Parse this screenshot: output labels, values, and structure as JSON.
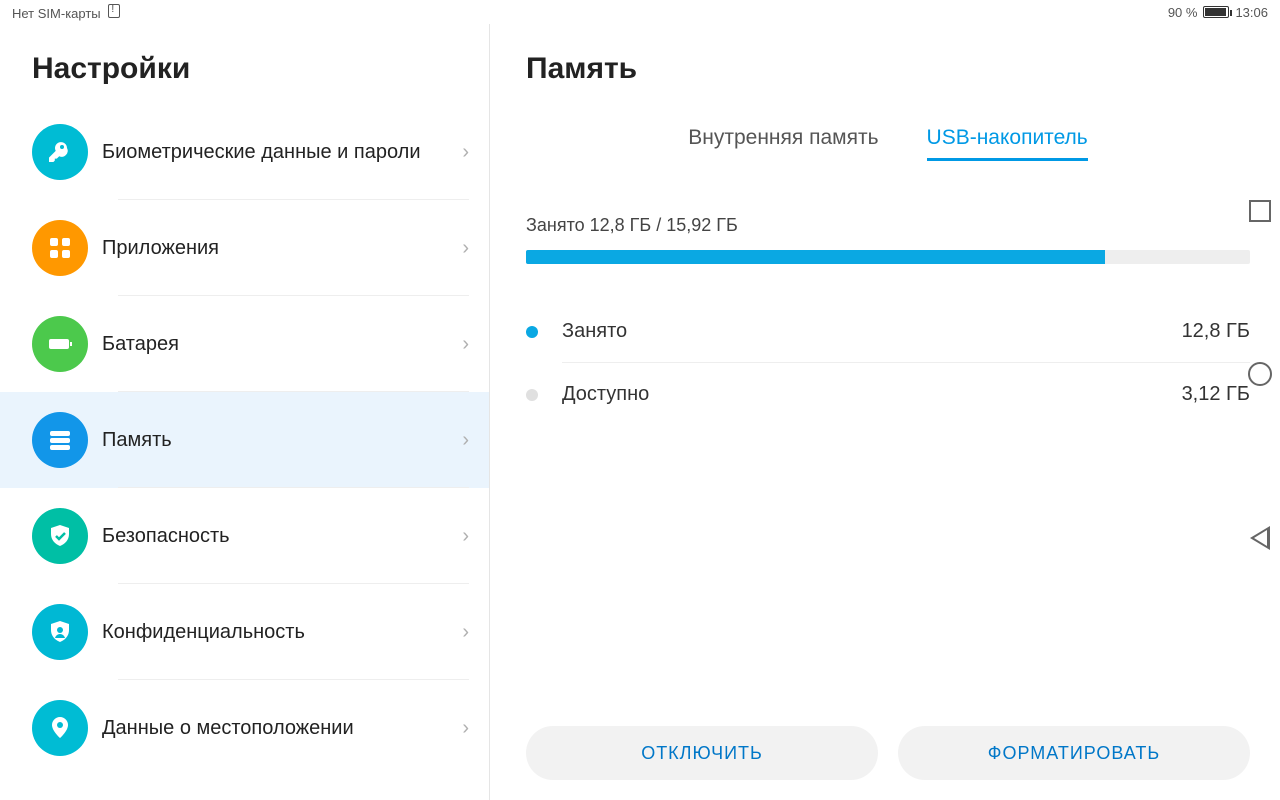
{
  "status": {
    "sim": "Нет SIM-карты",
    "battery_pct": "90 %",
    "time": "13:06"
  },
  "sidebar": {
    "title": "Настройки",
    "items": [
      {
        "label": "Биометрические данные и пароли",
        "icon": "key",
        "color": "c-teal"
      },
      {
        "label": "Приложения",
        "icon": "apps",
        "color": "c-orange"
      },
      {
        "label": "Батарея",
        "icon": "battery",
        "color": "c-green"
      },
      {
        "label": "Память",
        "icon": "storage",
        "color": "c-blue",
        "selected": true
      },
      {
        "label": "Безопасность",
        "icon": "shield",
        "color": "c-teal2"
      },
      {
        "label": "Конфиденциальность",
        "icon": "privacy",
        "color": "c-cyan"
      },
      {
        "label": "Данные о местоположении",
        "icon": "location",
        "color": "c-loc"
      }
    ]
  },
  "main": {
    "title": "Память",
    "tabs": [
      {
        "label": "Внутренняя память",
        "active": false
      },
      {
        "label": "USB-накопитель",
        "active": true
      }
    ],
    "usage_text": "Занято 12,8 ГБ / 15,92 ГБ",
    "usage_fraction": 0.8,
    "rows": [
      {
        "name": "Занято",
        "value": "12,8 ГБ",
        "dot": "#0aa8e3"
      },
      {
        "name": "Доступно",
        "value": "3,12 ГБ",
        "dot": "#e0e0e0"
      }
    ],
    "actions": {
      "eject": "ОТКЛЮЧИТЬ",
      "format": "ФОРМАТИРОВАТЬ"
    }
  }
}
